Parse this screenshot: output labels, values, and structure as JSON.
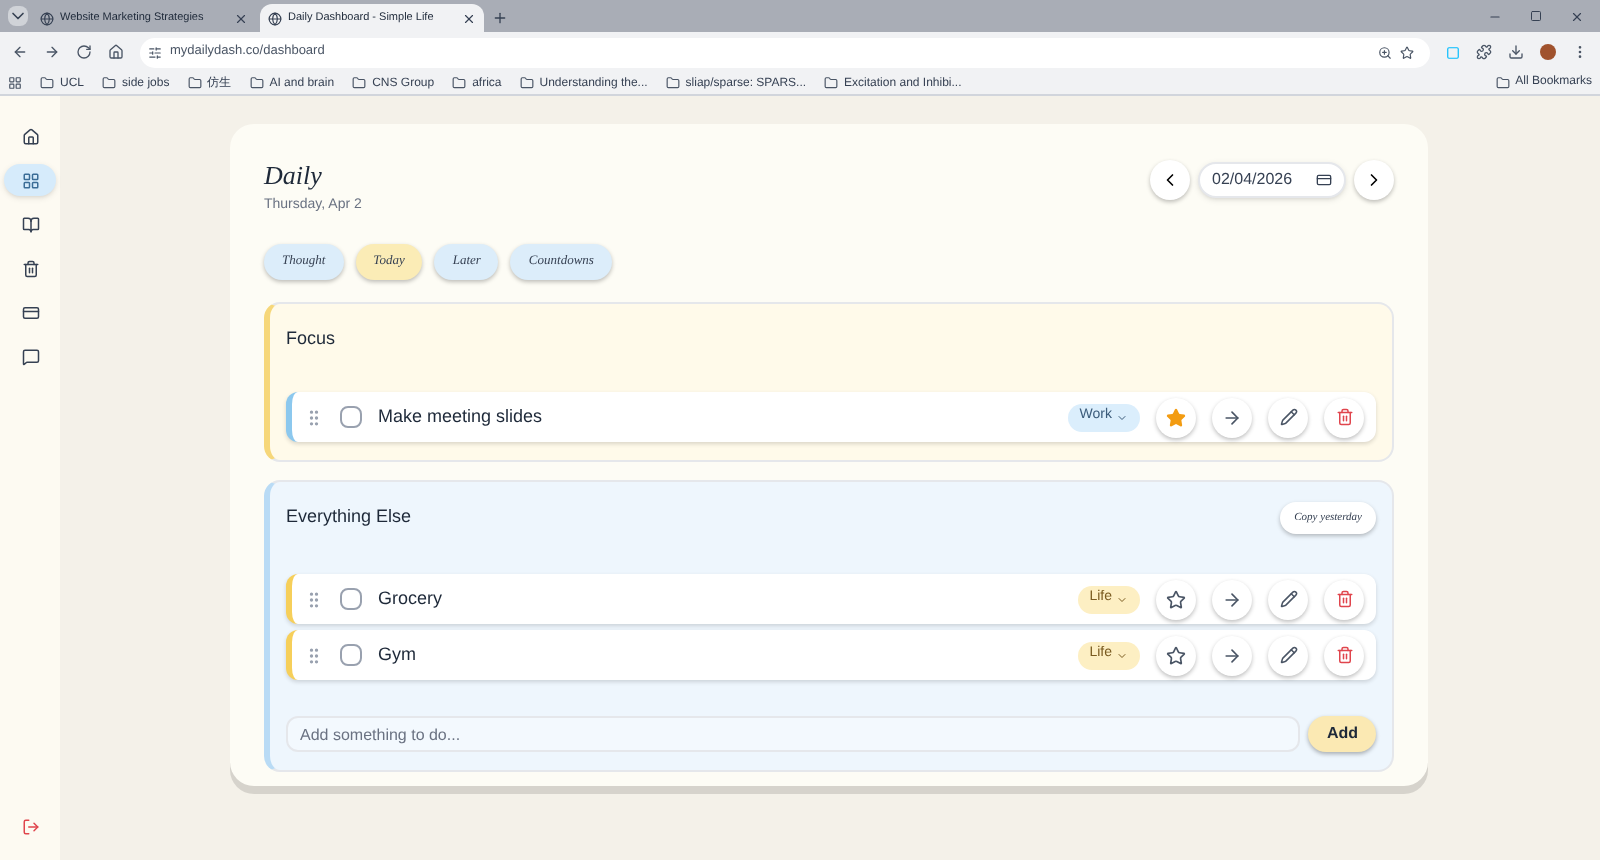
{
  "browser": {
    "tabs": [
      {
        "title": "Website Marketing Strategies",
        "selected": false
      },
      {
        "title": "Daily Dashboard - Simple Life",
        "selected": true
      }
    ],
    "url": "mydailydash.co/dashboard",
    "bookmarks": [
      "UCL",
      "side jobs",
      "仿生",
      "AI and brain",
      "CNS Group",
      "africa",
      "Understanding the...",
      "sliap/sparse: SPARS...",
      "Excitation and Inhibi..."
    ],
    "all_bookmarks": "All Bookmarks"
  },
  "sidebar": {
    "items": [
      {
        "kind": "home",
        "selected": false
      },
      {
        "kind": "grid",
        "selected": true
      },
      {
        "kind": "book",
        "selected": false
      },
      {
        "kind": "trash",
        "selected": false
      },
      {
        "kind": "card",
        "selected": false
      },
      {
        "kind": "chat",
        "selected": false
      }
    ]
  },
  "page": {
    "title": "Daily",
    "subtitle": "Thursday, Apr 2",
    "date": "02/04/2026",
    "tabs": [
      {
        "label": "Thought",
        "selected": false
      },
      {
        "label": "Today",
        "selected": true
      },
      {
        "label": "Later",
        "selected": false
      },
      {
        "label": "Countdowns",
        "selected": false
      }
    ],
    "sections": [
      {
        "kind": "focus",
        "title": "Focus",
        "tasks": [
          {
            "text": "Make meeting slides",
            "checked": false,
            "tag": "Work",
            "starred": true
          }
        ]
      },
      {
        "kind": "else",
        "title": "Everything Else",
        "action": "Copy yesterday",
        "tasks": [
          {
            "text": "Grocery",
            "checked": false,
            "tag": "Life",
            "starred": false
          },
          {
            "text": "Gym",
            "checked": false,
            "tag": "Life",
            "starred": false
          }
        ],
        "add": {
          "placeholder": "Add something to do...",
          "button": "Add"
        }
      }
    ]
  }
}
